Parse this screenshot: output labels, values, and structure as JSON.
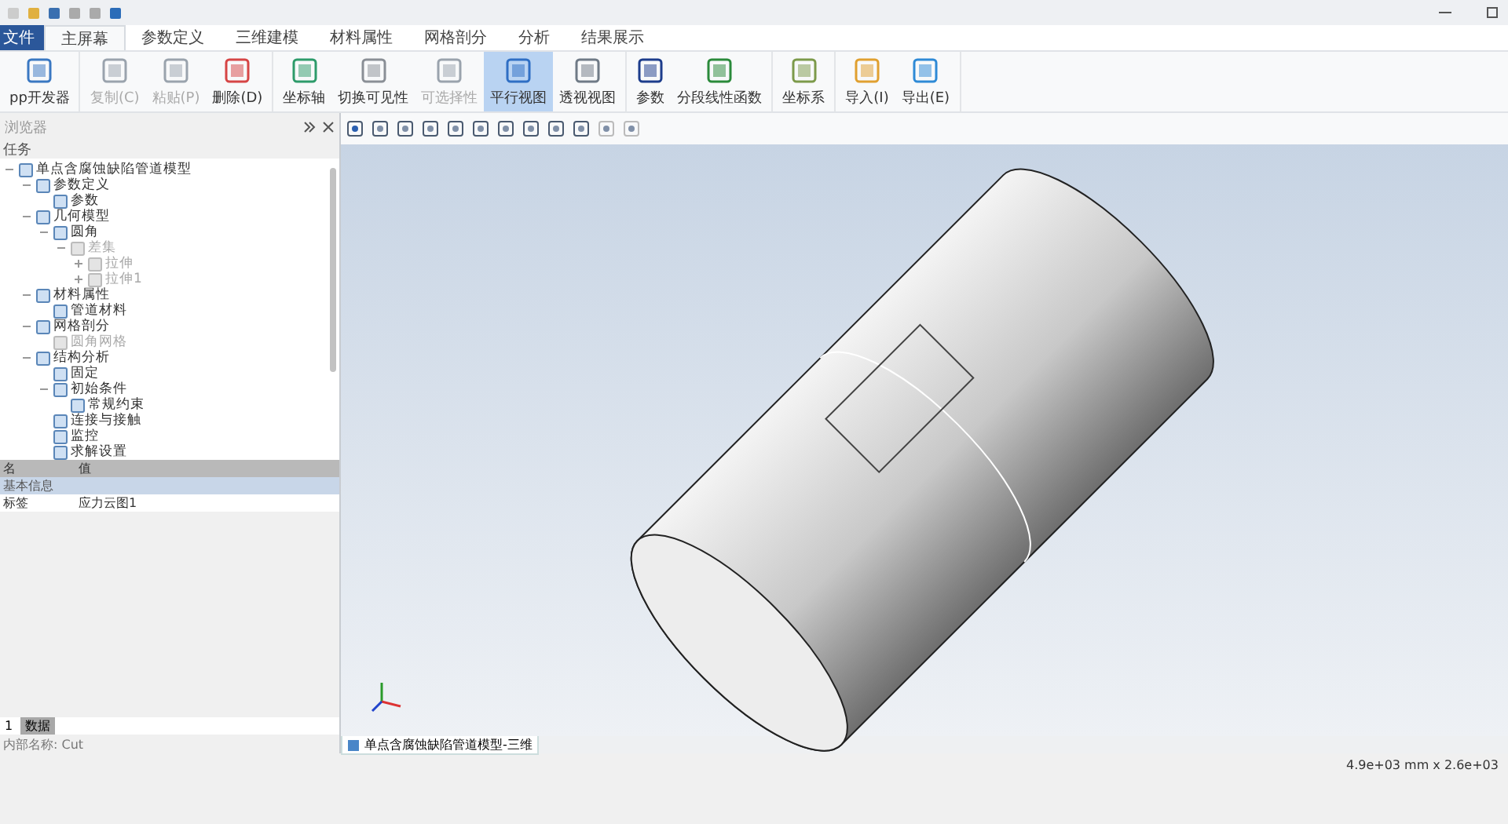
{
  "menu_tabs": [
    {
      "label": "文件",
      "selected": false,
      "kind": "file"
    },
    {
      "label": "主屏幕",
      "selected": true,
      "kind": "tab"
    },
    {
      "label": "参数定义",
      "selected": false,
      "kind": "tab"
    },
    {
      "label": "三维建模",
      "selected": false,
      "kind": "tab"
    },
    {
      "label": "材料属性",
      "selected": false,
      "kind": "tab"
    },
    {
      "label": "网格剖分",
      "selected": false,
      "kind": "tab"
    },
    {
      "label": "分析",
      "selected": false,
      "kind": "tab"
    },
    {
      "label": "结果展示",
      "selected": false,
      "kind": "tab"
    }
  ],
  "ribbon_groups": [
    [
      {
        "label": "pp开发器",
        "disabled": false,
        "selected": false
      }
    ],
    [
      {
        "label": "复制(C)",
        "disabled": true,
        "selected": false
      },
      {
        "label": "粘贴(P)",
        "disabled": true,
        "selected": false
      },
      {
        "label": "删除(D)",
        "disabled": false,
        "selected": false
      }
    ],
    [
      {
        "label": "坐标轴",
        "disabled": false,
        "selected": false
      },
      {
        "label": "切换可见性",
        "disabled": false,
        "selected": false
      },
      {
        "label": "可选择性",
        "disabled": true,
        "selected": false
      },
      {
        "label": "平行视图",
        "disabled": false,
        "selected": true
      },
      {
        "label": "透视视图",
        "disabled": false,
        "selected": false
      }
    ],
    [
      {
        "label": "参数",
        "disabled": false,
        "selected": false
      },
      {
        "label": "分段线性函数",
        "disabled": false,
        "selected": false
      }
    ],
    [
      {
        "label": "坐标系",
        "disabled": false,
        "selected": false
      }
    ],
    [
      {
        "label": "导入(I)",
        "disabled": false,
        "selected": false
      },
      {
        "label": "导出(E)",
        "disabled": false,
        "selected": false
      }
    ]
  ],
  "browser": {
    "title": "浏览器",
    "task_label": "任务",
    "tree": [
      {
        "label": "单点含腐蚀缺陷管道模型",
        "disabled": false,
        "expanded": true,
        "children": [
          {
            "label": "参数定义",
            "disabled": false,
            "expanded": true,
            "children": [
              {
                "label": "参数",
                "disabled": false
              }
            ]
          },
          {
            "label": "几何模型",
            "disabled": false,
            "expanded": true,
            "children": [
              {
                "label": "圆角",
                "disabled": false,
                "expanded": true,
                "children": [
                  {
                    "label": "差集",
                    "disabled": true,
                    "expanded": true,
                    "children": [
                      {
                        "label": "拉伸",
                        "disabled": true,
                        "expanded": false
                      },
                      {
                        "label": "拉伸1",
                        "disabled": true,
                        "expanded": false
                      }
                    ]
                  }
                ]
              }
            ]
          },
          {
            "label": "材料属性",
            "disabled": false,
            "expanded": true,
            "children": [
              {
                "label": "管道材料",
                "disabled": false
              }
            ]
          },
          {
            "label": "网格剖分",
            "disabled": false,
            "expanded": true,
            "children": [
              {
                "label": "圆角网格",
                "disabled": true
              }
            ]
          },
          {
            "label": "结构分析",
            "disabled": false,
            "expanded": true,
            "children": [
              {
                "label": "固定",
                "disabled": false
              },
              {
                "label": "初始条件",
                "disabled": false,
                "expanded": true,
                "children": [
                  {
                    "label": "常规约束",
                    "disabled": false
                  }
                ]
              },
              {
                "label": "连接与接触",
                "disabled": false
              },
              {
                "label": "监控",
                "disabled": false
              },
              {
                "label": "求解设置",
                "disabled": false
              }
            ]
          }
        ]
      }
    ]
  },
  "properties": {
    "columns": [
      "名",
      "值"
    ],
    "group": "基本信息",
    "rows": [
      {
        "name": "标签",
        "value": "应力云图1"
      }
    ]
  },
  "bottom_tabs": [
    {
      "label": "1",
      "selected": false
    },
    {
      "label": "数据",
      "selected": true
    }
  ],
  "internal_name": "内部名称: Cut",
  "document_tab": "单点含腐蚀缺陷管道模型-三维",
  "status_size": "4.9e+03 mm x 2.6e+03"
}
